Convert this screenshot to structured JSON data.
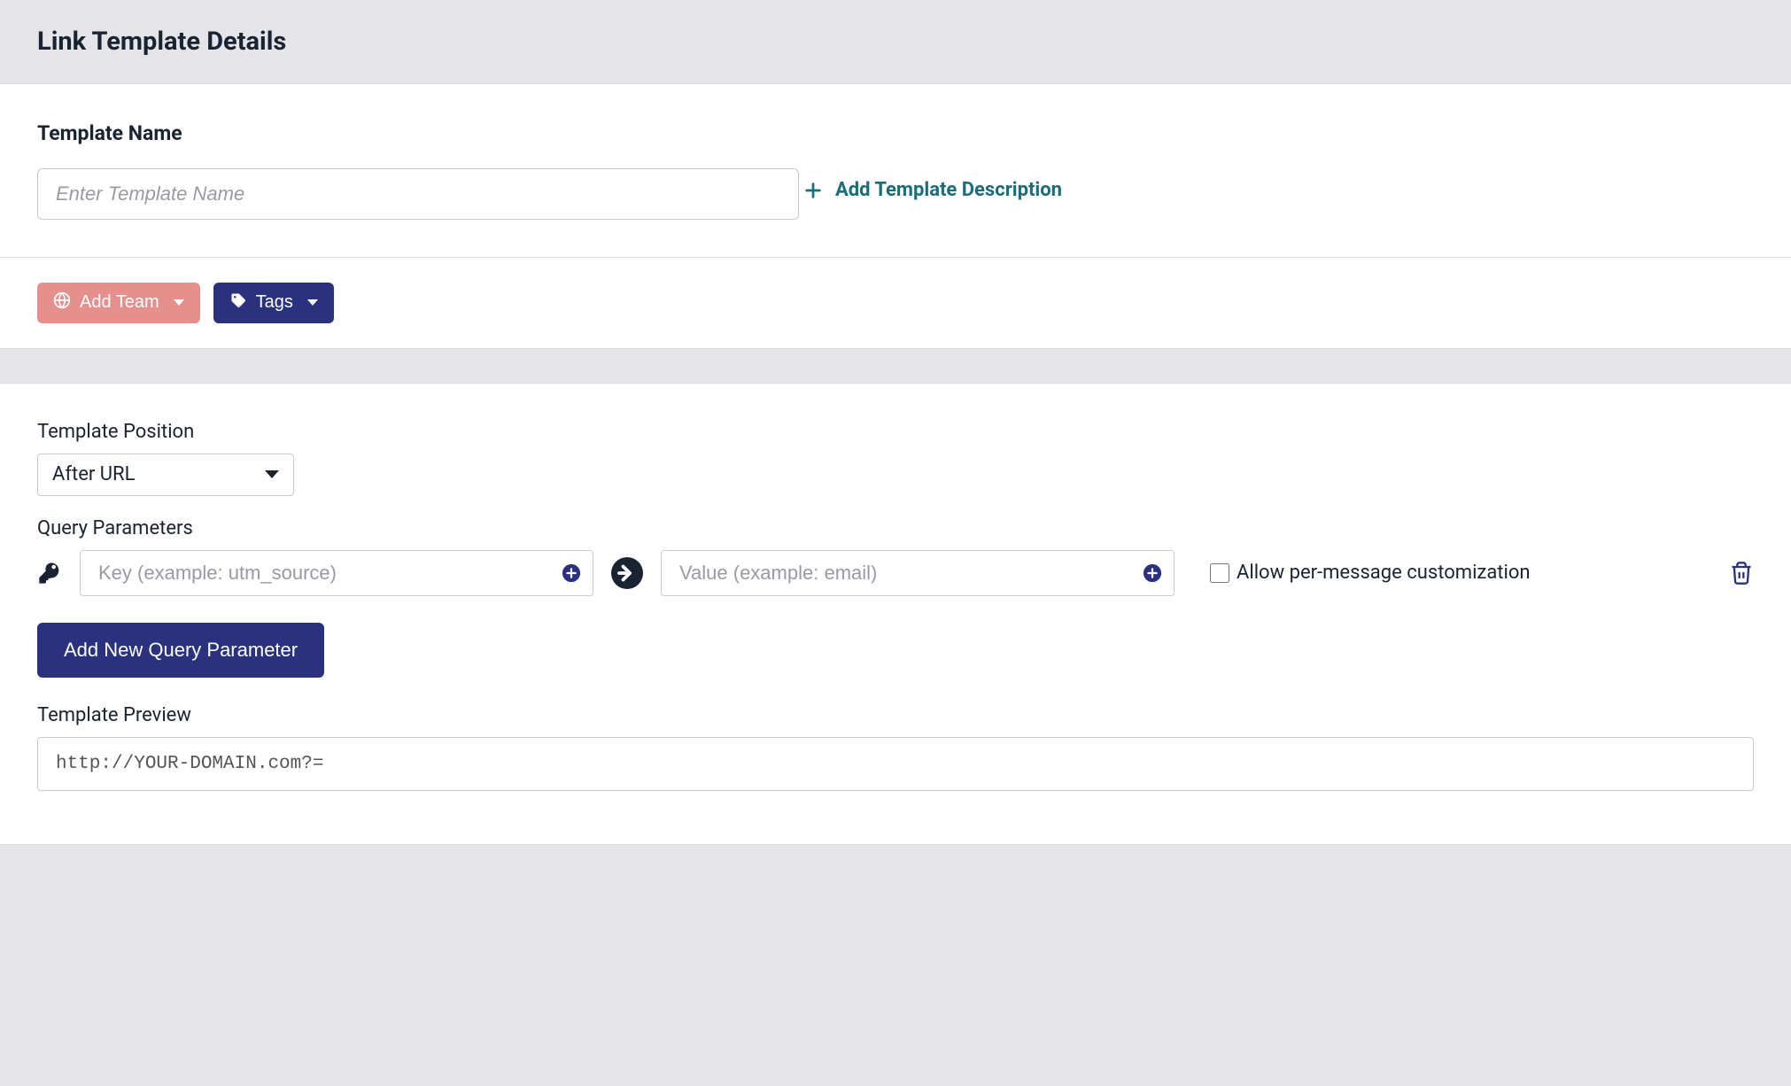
{
  "header": {
    "title": "Link Template Details"
  },
  "template_name": {
    "label": "Template Name",
    "placeholder": "Enter Template Name",
    "value": ""
  },
  "add_description": {
    "label": "Add Template Description"
  },
  "buttons": {
    "add_team": "Add Team",
    "tags": "Tags",
    "add_new_query_parameter": "Add New Query Parameter"
  },
  "position": {
    "label": "Template Position",
    "selected": "After URL"
  },
  "query_params": {
    "label": "Query Parameters",
    "key_placeholder": "Key (example: utm_source)",
    "value_placeholder": "Value (example: email)",
    "allow_customization_label": "Allow per-message customization"
  },
  "preview": {
    "label": "Template Preview",
    "value": "http://YOUR-DOMAIN.com?="
  },
  "icons": {
    "plus": "plus-icon",
    "globe": "globe-icon",
    "tag": "tag-icon",
    "caret_down": "caret-down-icon",
    "key": "key-icon",
    "plus_circle": "plus-circle-icon",
    "arrow_circle": "arrow-right-circle-icon",
    "trash": "trash-icon"
  },
  "colors": {
    "accent_teal": "#1a6e7a",
    "accent_navy": "#2a327f",
    "accent_coral": "#e68f8d"
  }
}
